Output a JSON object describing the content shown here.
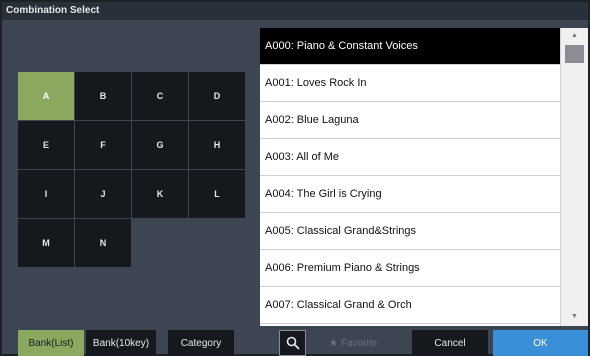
{
  "window": {
    "title": "Combination Select"
  },
  "banks": [
    "A",
    "B",
    "C",
    "D",
    "E",
    "F",
    "G",
    "H",
    "I",
    "J",
    "K",
    "L",
    "M",
    "N"
  ],
  "selected_bank": "A",
  "list": {
    "items": [
      "A000: Piano & Constant Voices",
      "A001: Loves Rock In",
      "A002: Blue Laguna",
      "A003: All of Me",
      "A004: The Girl is Crying",
      "A005: Classical Grand&Strings",
      "A006: Premium Piano & Strings",
      "A007: Classical Grand & Orch"
    ],
    "selected_index": 0
  },
  "scrollbar": {
    "up_glyph": "▲",
    "down_glyph": "▼"
  },
  "footer": {
    "bank_list": "Bank(List)",
    "bank_10key": "Bank(10key)",
    "category": "Category",
    "favorite_star": "★",
    "favorite": "Favorite",
    "cancel": "Cancel",
    "ok": "OK"
  },
  "icons": {
    "search": "search-icon",
    "favorite": "star-icon"
  },
  "colors": {
    "accent_green": "#8aa85e",
    "ok_blue": "#3a8fd8",
    "panel": "#3d4552",
    "cell": "#15181d"
  }
}
